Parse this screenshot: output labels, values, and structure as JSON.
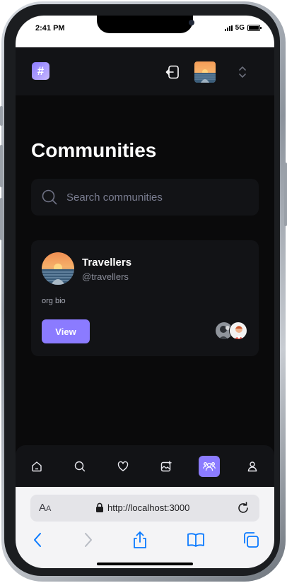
{
  "status_bar": {
    "time": "2:41 PM",
    "network": "5G"
  },
  "topbar": {
    "logo_glyph": "#",
    "logout_icon": "logout-icon",
    "avatar_icon": "sunset-avatar",
    "switch_icon": "chevron-up-down-icon"
  },
  "page": {
    "title": "Communities"
  },
  "search": {
    "placeholder": "Search communities",
    "value": ""
  },
  "community": {
    "name": "Travellers",
    "handle": "@travellers",
    "bio": "org bio",
    "view_label": "View"
  },
  "bottom_nav": {
    "items": [
      {
        "icon": "home-icon",
        "active": false
      },
      {
        "icon": "search-icon",
        "active": false
      },
      {
        "icon": "heart-icon",
        "active": false
      },
      {
        "icon": "create-post-icon",
        "active": false
      },
      {
        "icon": "communities-icon",
        "active": true
      },
      {
        "icon": "profile-icon",
        "active": false
      }
    ]
  },
  "browser": {
    "text_size_label_big": "A",
    "text_size_label_small": "A",
    "url": "http://localhost:3000"
  },
  "colors": {
    "accent": "#8b7bff",
    "background": "#0a0a0b",
    "surface": "#121316",
    "safari_blue": "#0a7aff"
  }
}
